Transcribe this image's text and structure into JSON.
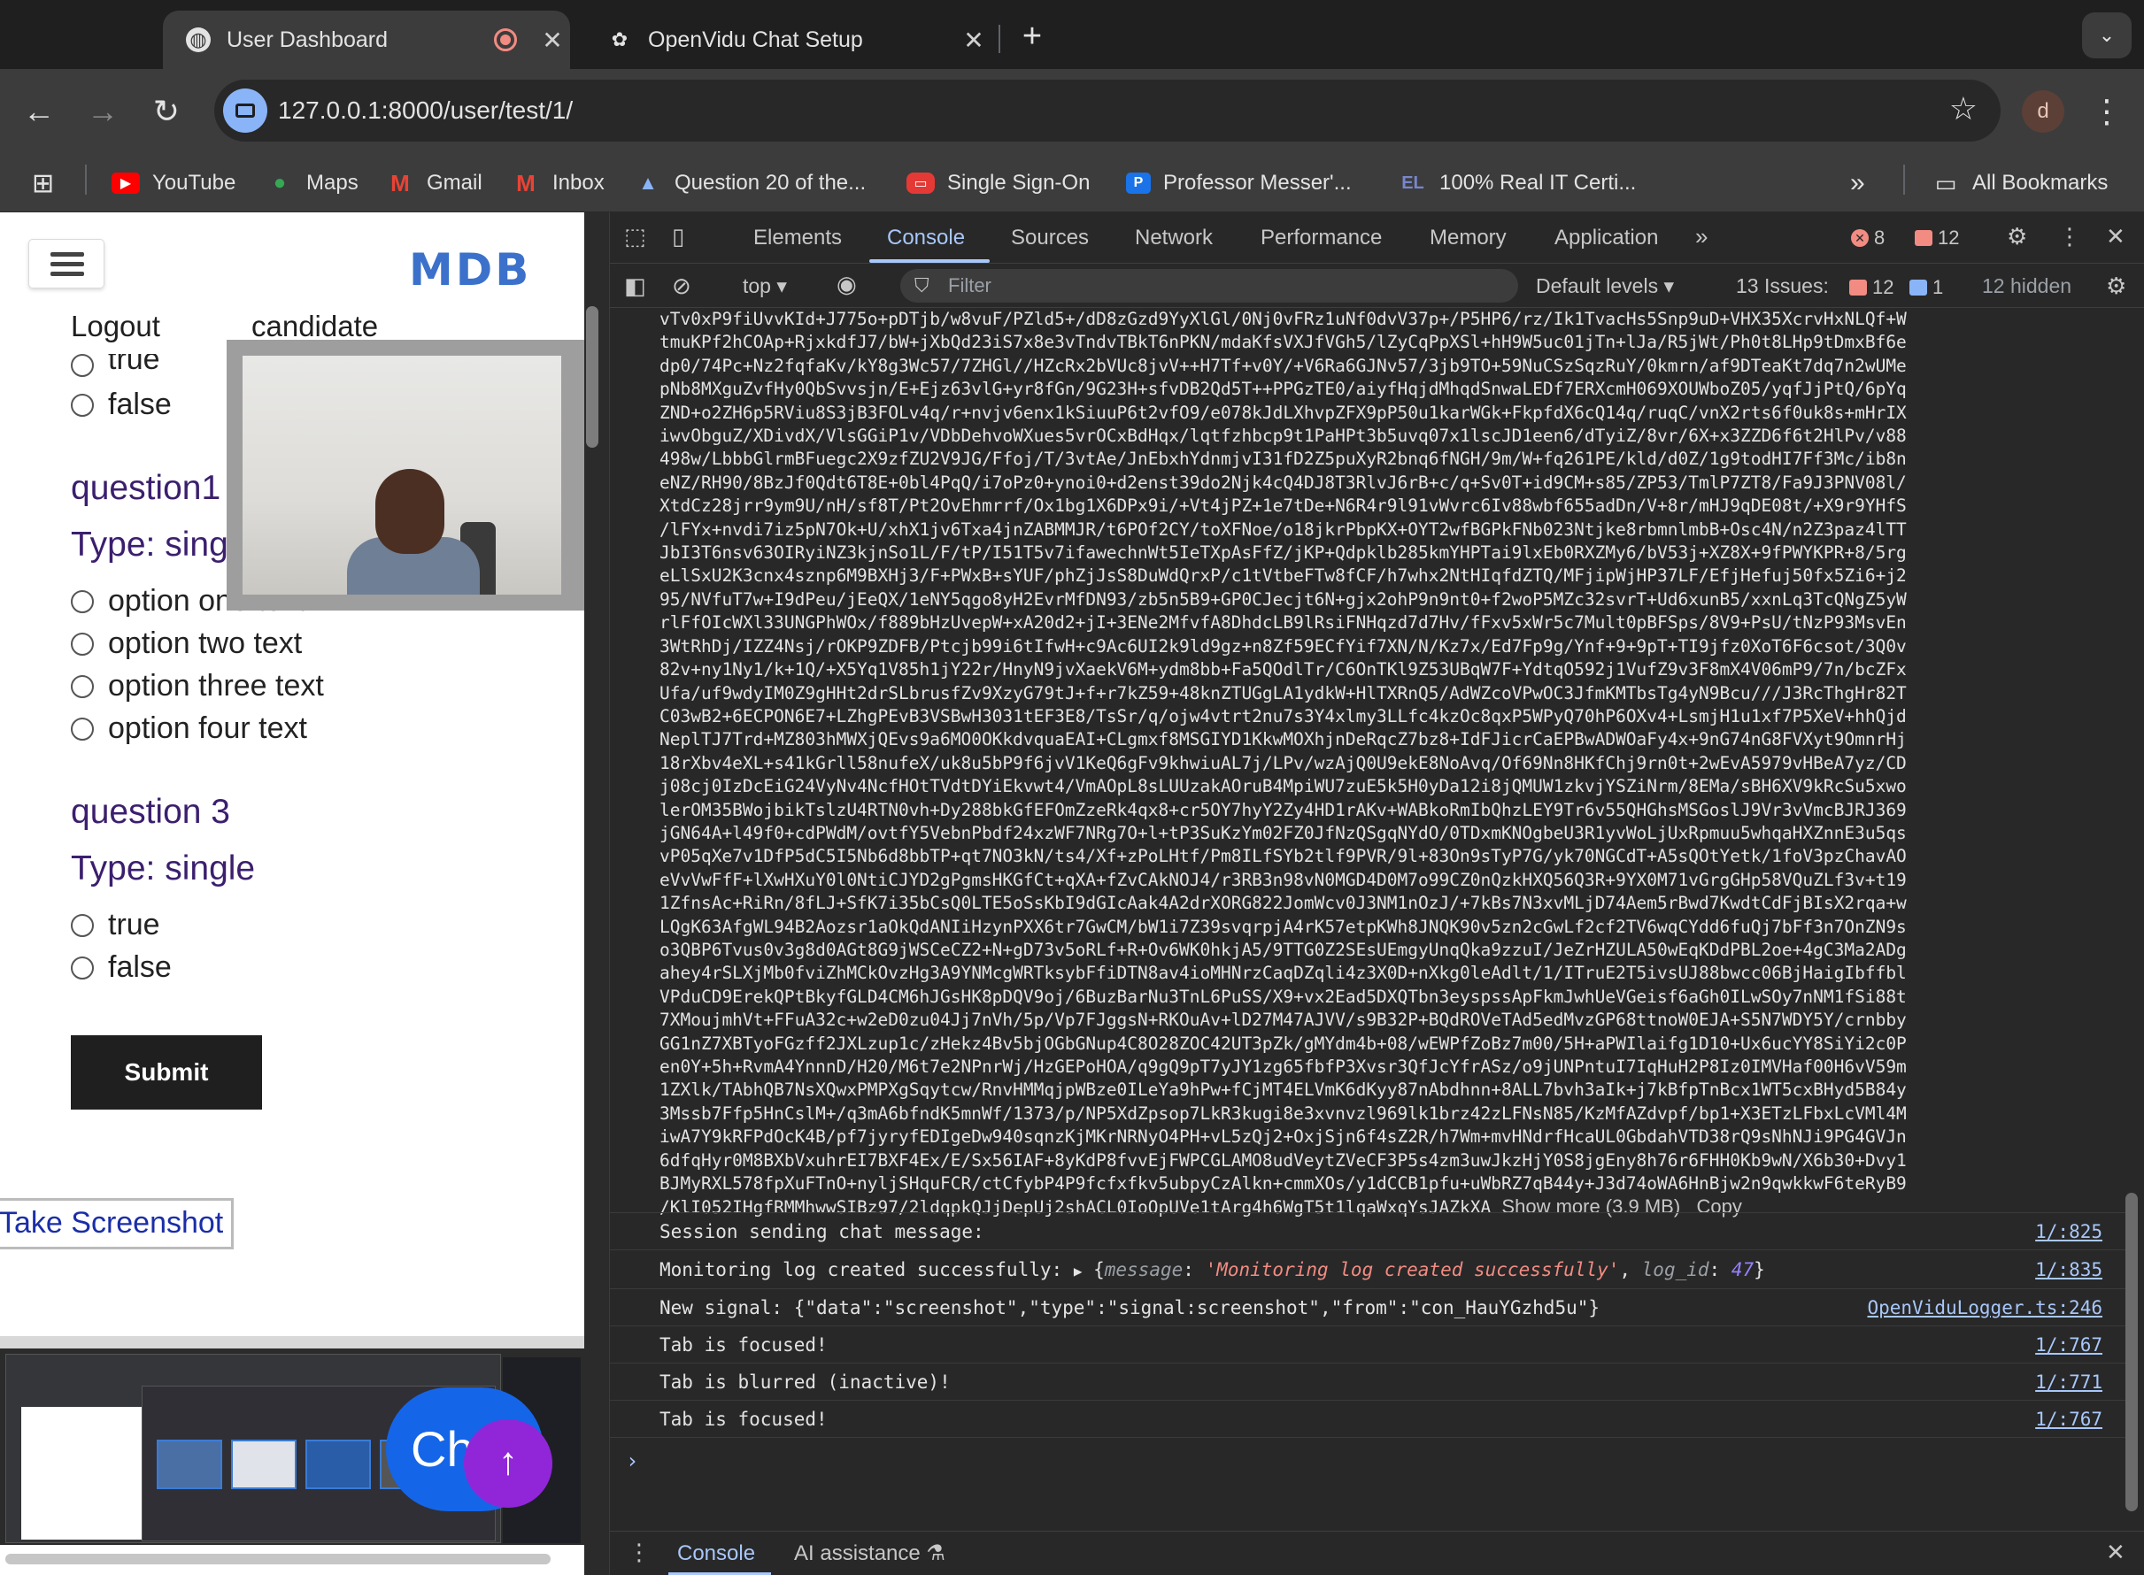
{
  "browser": {
    "tabs": [
      {
        "title": "User Dashboard",
        "active": true
      },
      {
        "title": "OpenVidu Chat Setup",
        "active": false
      }
    ],
    "new_tab": "+",
    "url": "127.0.0.1:8000/user/test/1/",
    "profile_initial": "d",
    "bookmarks": [
      {
        "label": "YouTube",
        "icon": "youtube-icon",
        "color": "#ff0000"
      },
      {
        "label": "Maps",
        "icon": "maps-icon",
        "color": "#34a853"
      },
      {
        "label": "Gmail",
        "icon": "gmail-icon",
        "color": "#ea4335"
      },
      {
        "label": "Inbox",
        "icon": "gmail-icon",
        "color": "#ea4335"
      },
      {
        "label": "Question 20 of the...",
        "icon": "exam-icon",
        "color": "#4285f4"
      },
      {
        "label": "Single Sign-On",
        "icon": "sso-icon",
        "color": "#e53935"
      },
      {
        "label": "Professor Messer'...",
        "icon": "messer-icon",
        "color": "#1a73e8"
      },
      {
        "label": "100% Real IT Certi...",
        "icon": "el-icon",
        "color": "#3f51b5"
      }
    ],
    "bookmarks_overflow": "»",
    "all_bookmarks": "All Bookmarks"
  },
  "page": {
    "logo": "MDB",
    "nav": {
      "logout": "Logout",
      "user": "candidate"
    },
    "partial_option": "true",
    "q_prev_false": "false",
    "question_1": {
      "title": "question1",
      "type": "Type: single",
      "options": [
        "option one text",
        "option two text",
        "option three text",
        "option four text"
      ]
    },
    "question_3": {
      "title": "question 3",
      "type": "Type: single",
      "options": [
        "true",
        "false"
      ]
    },
    "submit": "Submit",
    "take_screenshot": "Take Screenshot",
    "chat_button": "Ch",
    "scroll_top": "↑"
  },
  "devtools": {
    "tabs": [
      "Elements",
      "Console",
      "Sources",
      "Network",
      "Performance",
      "Memory",
      "Application"
    ],
    "active_tab": "Console",
    "errors_count": "8",
    "warnings_count": "12",
    "context": "top",
    "filter_placeholder": "Filter",
    "levels": "Default levels",
    "issues_label": "13 Issues:",
    "issues_warn": "12",
    "issues_info": "1",
    "hidden": "12 hidden",
    "base64_lines": [
      "vTv0xP9fiUvvKId+J775o+pDTjb/w8vuF/PZld5+/dD8zGzd9YyXlGl/0Nj0vFRz1uNf0dvV37p+/P5HP6/rz/Ik1TvacHs5Snp9uD+VHX35XcrvHxNLQf+W",
      "tmuKPf2hCOAp+RjxkdfJ7/bW+jXbQd23iS7x8e3vTndvTBkT6nPKN/mdaKfsVXJfVGh5/lZyCqPpXSl+hH9W5uc01jTn+lJa/R5jWt/Ph0t8LHp9tDmxBf6e",
      "dp0/74Pc+Nz2fqfaKv/kY8g3Wc57/7ZHGl//HZcRx2bVUc8jvV++H7Tf+v0Y/+V6Ra6GJNv57/3jb9TO+59NuCSzSqzRuY/0kmrn/af9DTeaKt7dq7n2wUMe",
      "pNb8MXguZvfHy0QbSvvsjn/E+Ejz63vlG+yr8fGn/9G23H+sfvDB2Qd5T++PPGzTE0/aiyfHqjdMhqdSnwaLEDf7ERXcmH069XOUWboZ05/yqfJjPtQ/6pYq",
      "ZND+o2ZH6p5RViu8S3jB3FOLv4q/r+nvjv6enx1kSiuuP6t2vfO9/e078kJdLXhvpZFX9pP50u1karWGk+FkpfdX6cQ14q/ruqC/vnX2rts6f0uk8s+mHrIX",
      "iwvObguZ/XDivdX/VlsGGiP1v/VDbDehvoWXues5vrOCxBdHqx/lqtfzhbcp9t1PaHPt3b5uvq07x1lscJD1een6/dTyiZ/8vr/6X+x3ZZD6f6t2HlPv/v88",
      "498w/LbbbGlrmBFuegc2X9zfZU2V9JG/Ffoj/T/3vtAe/JnEbxhYdnmjvI31fD2Z5puXyR2bnq6fNGH/9m/W+fq261PE/kld/d0Z/1g9todHI7Ff3Mc/ib8n",
      "eNZ/RH90/8BzJf0Qdt6T8E+0bl4PqQ/i7oPz0+ynoi0+d2enst39do2Njk4cQ4DJ8T3RlvJ6rB+c/q+Sv0T+id9CM+s85/ZP53/TmlP7ZT8/Fa9J3PNV08l/",
      "XtdCz28jrr9ym9U/nH/sf8T/Pt2OvEhmrrf/Ox1bg1X6DPx9i/+Vt4jPZ+1e7tDe+N6R4r9l91vWvrc6Iv88wbf655adDn/V+8r/mHJ9qDE08t/+X9r9YHfS",
      "/lFYx+nvdi7iz5pN7Ok+U/xhX1jv6Txa4jnZABMMJR/t6POf2CY/toXFNoe/o18jkrPbpKX+OYT2wfBGPkFNb023Ntjke8rbmnlmbB+Osc4N/n2Z3paz4lTT",
      "JbI3T6nsv63OIRyiNZ3kjnSo1L/F/tP/I51T5v7ifawechnWt5IeTXpAsFfZ/jKP+Qdpklb285kmYHPTai9lxEb0RXZMy6/bV53j+XZ8X+9fPWYKPR+8/5rg",
      "eLlSxU2K3cnx4sznp6M9BXHj3/F+PWxB+sYUF/phZjJsS8DuWdQrxP/c1tVtbeFTw8fCF/h7whx2NtHIqfdZTQ/MFjipWjHP37LF/EfjHefuj50fx5Zi6+j2",
      "95/NVfuT7w+I9dPeu/jEeQX/1eNY5qgo8yH2EvrMfDN93/zb5n5B9+GP0CJecjt6N+gjx2ohP9n9nt0+f2woP5MZc32svrT+Ud6xunB5/xxnLq3TcQNgZ5yW",
      "rlFfOIcWXl33UNGPhWOx/f889bHzUvepW+xA20d2+jI+3ENe2MfvfA8DhdcLB9lRsiFNHqzd7d7Hv/fFxv5xWr5c7Mult0pBFSps/8V9+PsU/tNzP93MsvEn",
      "3WtRhDj/IZZ4Nsj/rOKP9ZDFB/Ptcjb99i6tIfwH+c9Ac6UI2k9ld9gz+n8Zf59ECfYif7XN/N/Kz7x/Ed7Fp9g/Ynf+9+9pT+TI9jfz0XoT6F6csot/3Q0v",
      "82v+ny1Ny1/k+1Q/+X5Yq1V85h1jY22r/HnyN9jvXaekV6M+ydm8bb+Fa5QOdlTr/C6OnTKl9Z53UBqW7F+YdtqO592j1VufZ9v3F8mX4V06mP9/7n/bcZFx",
      "Ufa/uf9wdyIM0Z9gHHt2drSLbrusfZv9XzyG79tJ+f+r7kZ59+48knZTUGgLA1ydkW+HlTXRnQ5/AdWZcoVPwOC3JfmKMTbsTg4yN9Bcu///J3RcThgHr82T",
      "C03wB2+6ECPON6E7+LZhgPEvB3VSBwH3031tEF3E8/TsSr/q/ojw4vtrt2nu7s3Y4xlmy3LLfc4kzOc8qxP5WPyQ70hP6OXv4+LsmjH1u1xf7P5XeV+hhQjd",
      "NeplTJ7Trd+MZ803hMWXjQEvs9a6MO0OKkdvquaEAI+CLgmxf8MSGIYD1KkwMOXhjnDeRqcZ7bz8+IdFJicrCaEPBwADWOaFy4x+9nG74nG8FVXyt9OmnrHj",
      "18rXbv4eXL+s41kGrll58nufeX/uk8u5bP9f6jvV1KeQ6gFv9khwiuAL7j/LPv/wzAjQ0U9ekE8NoAvq/Of69Nn8HKfChj9rn0t+2wEvA5979vHBeA7yz/CD",
      "j08cj0IzDcEiG24VyNv4NcfHOtTVdtDYiEkvwt4/VmAOpL8sLUUzakAOruB4MpiWU7zuE5k5H0yDa12i8jQMUW1zkvjYSZiNrm/8EMa/sBH6XV9kRcSu5xwo",
      "lerOM35BWojbikTslzU4RTN0vh+Dy288bkGfEFOmZzeRk4qx8+cr5OY7hyY2Zy4HD1rAKv+WABkoRmIbQhzLEY9Tr6v55QHGhsMSGoslJ9Vr3vVmcBJRJ369",
      "jGN64A+l49f0+cdPWdM/ovtfY5VebnPbdf24xzWF7NRg7O+l+tP3SuKzYm02FZ0JfNzQSgqNYdO/0TDxmKNOgbeU3R1yvWoLjUxRpmuu5whqaHXZnnE3u5qs",
      "vP05qXe7v1DfP5dC5I5Nb6d8bbTP+qt7NO3kN/ts4/Xf+zPoLHtf/Pm8ILfSYb2tlf9PVR/9l+83On9sTyP7G/yk70NGCdT+A5sQOtYetk/1foV3pzChavAO",
      "eVvVwFfF+lXwHXuY0l0NtiCJYD2gPgmsHKGfCt+qXA+fZvCAkNOJ4/r3RB3n98vN0MGD4D0M7o99CZ0nQzkHXQ56Q3R+9YX0M71vGrgGHp58VQuZLf3v+t19",
      "1ZfnsAc+RiRn/8fLJ+SfK7i35bCsQ0LTE5oSsKbI9dGIcAak4A2drXORG822JomWcv0J3NM1nOzJ/+7kBs7N3xvMLjD74Aem5rBwd7KwdtCdFjBIsX2rqa+w",
      "LQgK63AfgWL94B2Aozsr1aOkQdANIiHzynPXX6tr7GwCM/bW1i7Z39svqrpjA4rK57etpKWh8JNQK90v5zn2cGwLf2cf2TV6wqCYdd6fuQj7bFf3n7OnZN9s",
      "o3QBP6Tvus0v3g8d0AGt8G9jWSCeCZ2+N+gD73v5oRLf+R+Ov6WK0hkjA5/9TTG0Z2SEsUEmgyUnqQka9zzuI/JeZrHZULA50wEqKDdPBL2oe+4gC3Ma2ADg",
      "ahey4rSLXjMb0fviZhMCkOvzHg3A9YNMcgWRTksybFfiDTN8av4ioMHNrzCaqDZqli4z3X0D+nXkg0leAdlt/1/ITruE2T5ivsUJ88bwcc06BjHaigIbffbl",
      "VPduCD9ErekQPtBkyfGLD4CM6hJGsHK8pDQV9oj/6BuzBarNu3TnL6PuSS/X9+vx2Ead5DXQTbn3eyspssApFkmJwhUeVGeisf6aGh0ILwSOy7nNM1fSi88t",
      "7XMoujmhVt+FFuA32c+w2eD0zu04Jj7nVh/5p/Vp7FJggsN+RKOuAv+lD27M47AJVV/s9B32P+BQdROVeTAd5edMvzGP68ttnoW0EJA+S5N7WDY5Y/crnbby",
      "GG1nZ7XBTyoFGzff2JXLzup1c/zHekz4Bv5bjOGbGNup4C8O28ZOC42UT3pZk/gMYdm4b+08/wEWPfZoBz7m00/5H+aPWIlaifg1D10+Ux6ucYY8SiYi2c0P",
      "en0Y+5h+RvmA4YnnnD/H20/M6t7e2NPnrWj/HzGEPoHOA/q9gQ9pT7yJY1zg65fbfP3Xvsr3QfJcYfrASz/o9jUNPntuI7IqHuH2P8Iz0IMVHaf00H6vV59m",
      "1ZXlk/TAbhQB7NsXQwxPMPXgSqytcw/RnvHMMqjpWBze0ILeYa9hPw+fCjMT4ELVmK6dKyy87nAbdhnn+8ALL7bvh3aIk+j7kBfpTnBcx1WT5cxBHyd5B84y",
      "3Mssb7Ffp5HnCslM+/q3mA6bfndK5mnWf/1373/p/NP5XdZpsop7LkR3kugi8e3xvnvzl969lk1brz42zLFNsN85/KzMfAZdvpf/bp1+X3ETzLFbxLcVMl4M",
      "iwA7Y9kRFPdOcK4B/pf7jyryfEDIgeDw940sqnzKjMKrNRNyO4PH+vL5zQj2+OxjSjn6f4sZ2R/h7Wm+mvHNdrfHcaUL0GbdahVTD38rQ9sNhNJi9PG4GVJn",
      "6dfqHyr0M8BXbVxuhrEI7BXF4Ex/E/Sx56IAF+8yKdP8fvvEjFWPCGLAMO8udVeytZVeCF3P5s4zm3uwJkzHjY0S8jgEny8h76r6FHH0Kb9wN/X6b30+Dvy1",
      "BJMyRXL578fpXuFTnO+nyljSHquFCR/ctCfybP4P9fcfxfkv5ubpyCzAlkn+cmmXOs/y1dCCB1pfu+uWbRZ7qB44y+J3d74oWA6HnBjw2n9qwkkwF6teRyB9",
      "/KlI052IHgfRMMhwwSIBz97/2ldqpkQJjDepUj2shACL0IoOpUVe1tArg4h6WgT5t1lqaWxqYsJAZkXA"
    ],
    "show_more": "Show more (3.9 MB)",
    "copy": "Copy",
    "logs": [
      {
        "message": "Session sending chat message:",
        "source": "1/:825"
      },
      {
        "message": "Monitoring log created successfully:",
        "object": {
          "message": "'Monitoring log created successfully'",
          "log_id": "47"
        },
        "source": "1/:835"
      },
      {
        "message": "New signal: {\"data\":\"screenshot\",\"type\":\"signal:screenshot\",\"from\":\"con_HauYGzhd5u\"}",
        "source": "OpenViduLogger.ts:246"
      },
      {
        "message": "Tab is focused!",
        "source": "1/:767"
      },
      {
        "message": "Tab is blurred (inactive)!",
        "source": "1/:771"
      },
      {
        "message": "Tab is focused!",
        "source": "1/:767"
      }
    ],
    "prompt": "›",
    "drawer_tabs": [
      "Console",
      "AI assistance"
    ]
  }
}
